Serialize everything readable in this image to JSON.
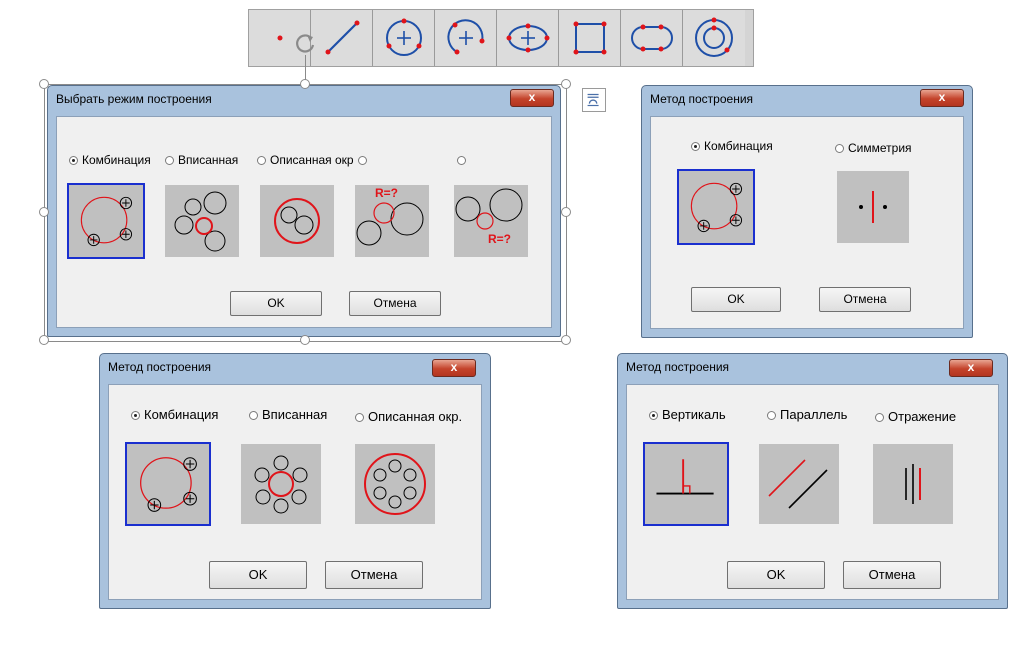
{
  "toolbar": {
    "buttons": [
      {
        "icon": "point-icon"
      },
      {
        "icon": "line-icon"
      },
      {
        "icon": "circle-center-icon"
      },
      {
        "icon": "arc-icon"
      },
      {
        "icon": "ellipse-icon"
      },
      {
        "icon": "rectangle-icon"
      },
      {
        "icon": "oval-icon"
      },
      {
        "icon": "concentric-circles-icon"
      }
    ]
  },
  "dialog1": {
    "title": "Выбрать режим построения",
    "close": "x",
    "options": [
      "Комбинация",
      "Вписанная",
      "Описанная окр.",
      "",
      ""
    ],
    "selected": 0,
    "pic_labels": {
      "r1": "R=?",
      "r2": "R=?"
    },
    "ok": "OK",
    "cancel": "Отмена"
  },
  "dialog2": {
    "title": "Метод построения",
    "close": "x",
    "options": [
      "Комбинация",
      "Симметрия"
    ],
    "selected": 0,
    "ok": "OK",
    "cancel": "Отмена"
  },
  "dialog3": {
    "title": "Метод построения",
    "close": "x",
    "options": [
      "Комбинация",
      "Вписанная",
      "Описанная окр."
    ],
    "selected": 0,
    "ok": "OK",
    "cancel": "Отмена"
  },
  "dialog4": {
    "title": "Метод построения",
    "close": "x",
    "options": [
      "Вертикаль",
      "Параллель",
      "Отражение"
    ],
    "selected": 0,
    "ok": "OK",
    "cancel": "Отмена"
  },
  "colors": {
    "accent_red": "#e0141a",
    "select_blue": "#1a2fcf",
    "title_bar": "#a9c2dd",
    "close_red": "#c4432b"
  }
}
